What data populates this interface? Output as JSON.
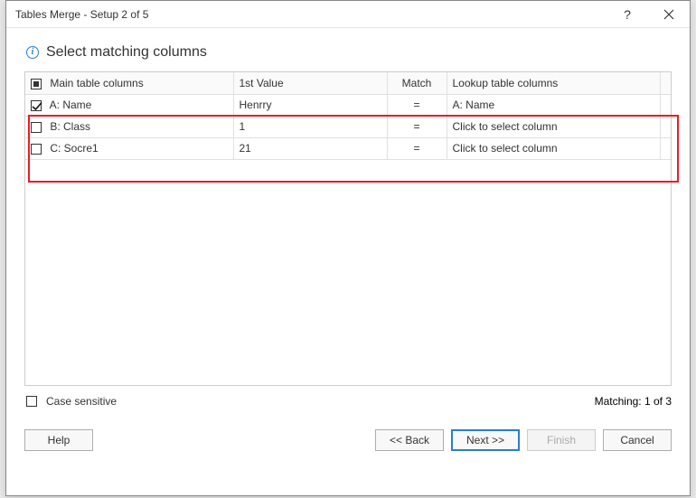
{
  "window": {
    "title": "Tables Merge - Setup 2 of 5"
  },
  "heading": "Select matching columns",
  "table": {
    "headers": {
      "main": "Main table columns",
      "value": "1st Value",
      "match": "Match",
      "lookup": "Lookup table columns"
    },
    "rows": [
      {
        "checked": true,
        "main": "A: Name",
        "value": "Henrry",
        "match": "=",
        "lookup": "A: Name",
        "lookup_placeholder": false
      },
      {
        "checked": false,
        "main": "B: Class",
        "value": "1",
        "match": "=",
        "lookup": "Click to select column",
        "lookup_placeholder": true
      },
      {
        "checked": false,
        "main": "C: Socre1",
        "value": "21",
        "match": "=",
        "lookup": "Click to select column",
        "lookup_placeholder": true
      }
    ]
  },
  "footer": {
    "case_sensitive_label": "Case sensitive",
    "matching_label": "Matching: 1 of 3",
    "help": "Help",
    "back": "<< Back",
    "next": "Next >>",
    "finish": "Finish",
    "cancel": "Cancel"
  }
}
